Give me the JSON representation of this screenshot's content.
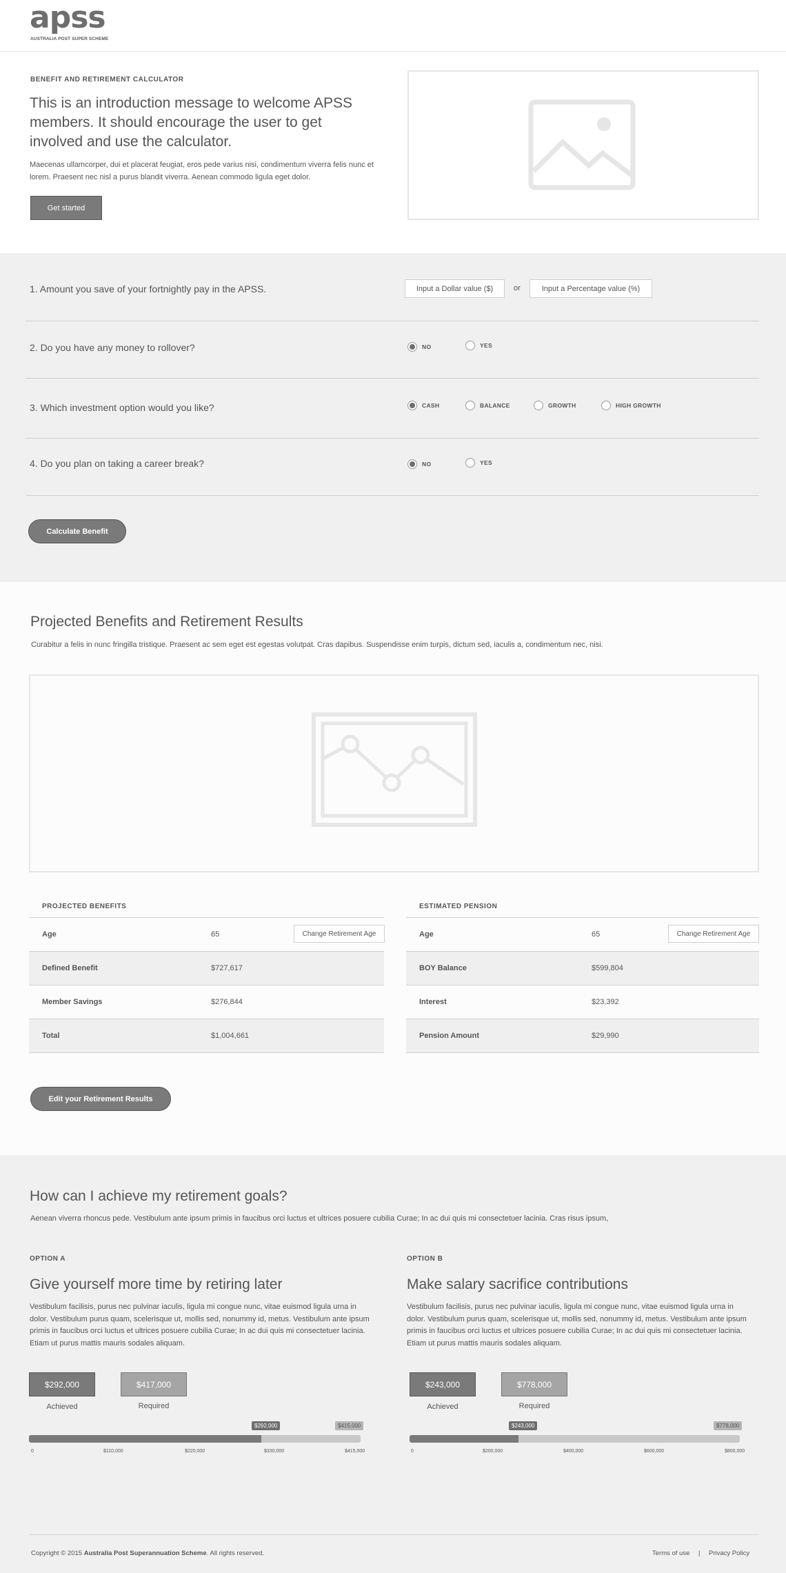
{
  "header": {
    "logo_word": "apss",
    "logo_sub": "AUSTRALIA POST SUPER SCHEME"
  },
  "intro": {
    "kicker": "BENEFIT AND RETIREMENT CALCULATOR",
    "title": "This is an introduction message to welcome APSS members. It should encourage the user to get involved and use the calculator.",
    "body": "Maecenas ullamcorper, dui et placerat feugiat, eros pede varius nisi, condimentum viverra felis nunc et lorem. Praesent nec nisl a purus blandit viverra. Aenean commodo ligula eget dolor.",
    "cta": "Get started",
    "image_icon": "image-placeholder-icon"
  },
  "form": {
    "q1": {
      "text": "1. Amount you save of your fortnightly pay in the APSS.",
      "dollar_btn": "Input a Dollar value ($)",
      "or": "or",
      "percent_btn": "Input a Percentage value (%)"
    },
    "q2": {
      "text": "2. Do you have any money to rollover?",
      "options": [
        "NO",
        "YES"
      ],
      "selected": "NO"
    },
    "q3": {
      "text": "3. Which investment option would you like?",
      "options": [
        "CASH",
        "BALANCE",
        "GROWTH",
        "HIGH GROWTH"
      ],
      "selected": "CASH"
    },
    "q4": {
      "text": "4. Do you plan on taking a career break?",
      "options": [
        "NO",
        "YES"
      ],
      "selected": "NO"
    },
    "submit": "Calculate Benefit"
  },
  "results": {
    "title": "Projected Benefits and Retirement Results",
    "subtitle": "Curabitur a felis in nunc fringilla tristique. Praesent ac sem eget est egestas volutpat. Cras dapibus. Suspendisse enim turpis, dictum sed, iaculis a, condimentum nec, nisi.",
    "chart_icon": "line-chart-placeholder-icon",
    "projected": {
      "heading": "PROJECTED BENEFITS",
      "age_label": "Age",
      "age_value": "65",
      "change_btn": "Change Retirement Age",
      "rows": [
        {
          "label": "Defined Benefit",
          "value": "$727,617"
        },
        {
          "label": "Member Savings",
          "value": "$276,844"
        },
        {
          "label": "Total",
          "value": "$1,004,661"
        }
      ]
    },
    "pension": {
      "heading": "ESTIMATED PENSION",
      "age_label": "Age",
      "age_value": "65",
      "change_btn": "Change Retirement Age",
      "rows": [
        {
          "label": "BOY Balance",
          "value": "$599,804"
        },
        {
          "label": "Interest",
          "value": "$23,392"
        },
        {
          "label": "Pension Amount",
          "value": "$29,990"
        }
      ]
    },
    "edit_btn": "Edit your Retirement Results"
  },
  "goals": {
    "title": "How can I achieve my retirement goals?",
    "subtitle": "Aenean viverra rhoncus pede. Vestibulum ante ipsum primis in faucibus orci luctus et ultrices posuere cubilia Curae; In ac dui quis mi consectetuer lacinia. Cras risus ipsum,",
    "option_a": {
      "kicker": "OPTION A",
      "title": "Give yourself more time by retiring later",
      "body": "Vestibulum facilisis, purus nec pulvinar iaculis, ligula mi congue nunc, vitae euismod ligula urna in dolor. Vestibulum purus quam, scelerisque ut, mollis sed, nonummy id, metus. Vestibulum ante ipsum primis in faucibus orci luctus et ultrices posuere cubilia Curae; In ac dui quis mi consectetuer lacinia. Etiam ut purus mattis mauris sodales aliquam.",
      "achieved_value": "$292,000",
      "achieved_label": "Achieved",
      "required_value": "$417,000",
      "required_label": "Required",
      "progress_fraction": 0.7,
      "marker_tag": "$292,000",
      "end_tag": "$415,000",
      "ticks": [
        "0",
        "$110,000",
        "$220,000",
        "$330,000",
        "$415,000"
      ]
    },
    "option_b": {
      "kicker": "OPTION B",
      "title": "Make salary sacrifice contributions",
      "body": "Vestibulum facilisis, purus nec pulvinar iaculis, ligula mi congue nunc, vitae euismod ligula urna in dolor. Vestibulum purus quam, scelerisque ut, mollis sed, nonummy id, metus. Vestibulum ante ipsum primis in faucibus orci luctus et ultrices posuere cubilia Curae; In ac dui quis mi consectetuer lacinia. Etiam ut purus mattis mauris sodales aliquam.",
      "achieved_value": "$243,000",
      "achieved_label": "Achieved",
      "required_value": "$778,000",
      "required_label": "Required",
      "progress_fraction": 0.33,
      "marker_tag": "$243,000",
      "end_tag": "$778,000",
      "ticks": [
        "0",
        "$200,000",
        "$400,000",
        "$600,000",
        "$800,000"
      ]
    }
  },
  "footer": {
    "copyright_pre": "Copyright © 2015",
    "copyright_org": "Australia Post Superannuation Scheme",
    "copyright_post": ". All rights reserved.",
    "terms": "Terms of use",
    "sep": "|",
    "privacy": "Privacy Policy"
  }
}
